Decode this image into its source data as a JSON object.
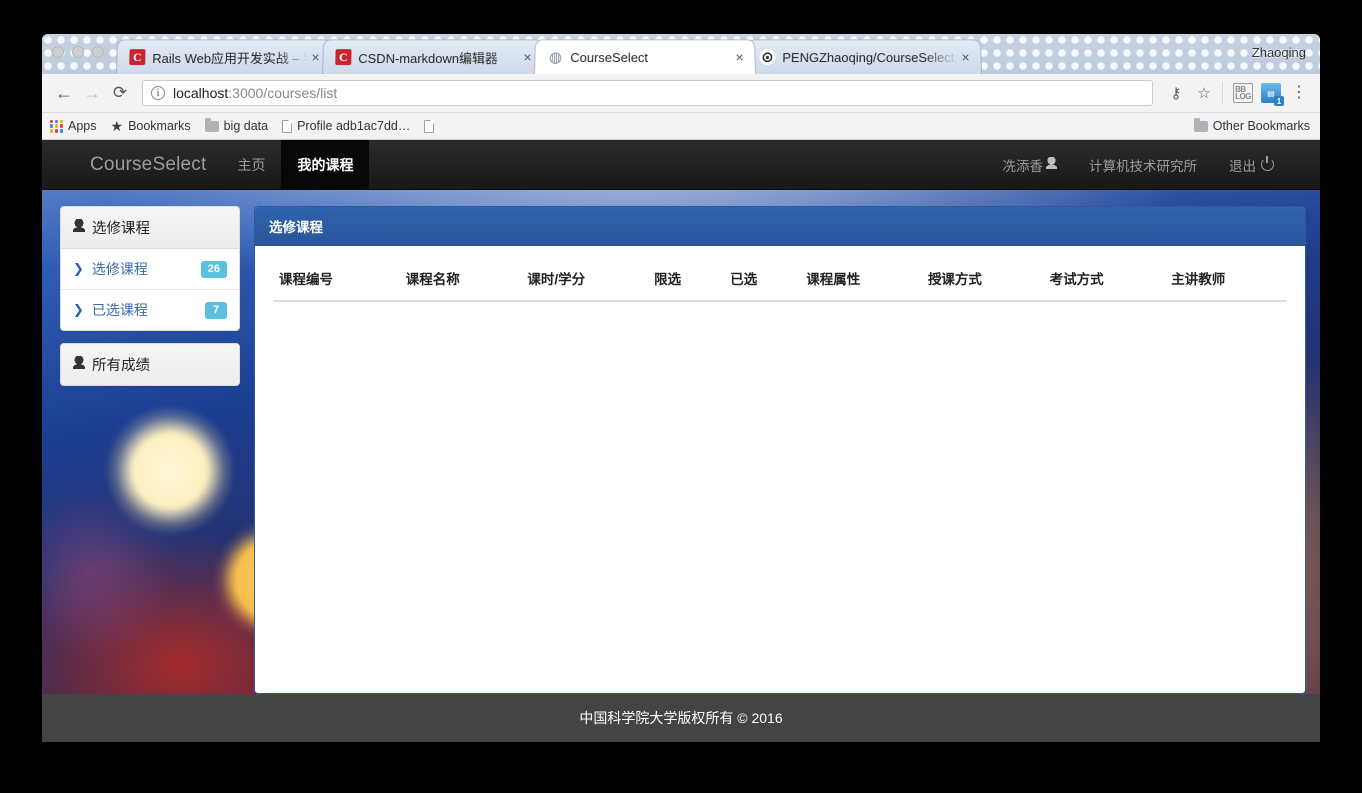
{
  "browser": {
    "window_user": "Zhaoqing",
    "tabs": [
      {
        "title": "Rails Web应用开发实战 – 学生选课系统",
        "favicon": "csdn-icon",
        "active": false,
        "close_label": "×"
      },
      {
        "title": "CSDN-markdown编辑器",
        "favicon": "csdn-icon",
        "active": false,
        "close_label": "×"
      },
      {
        "title": "CourseSelect",
        "favicon": "page-icon",
        "active": true,
        "close_label": "×"
      },
      {
        "title": "PENGZhaoqing/CourseSelect:",
        "favicon": "github-icon",
        "active": false,
        "close_label": "×"
      }
    ],
    "toolbar": {
      "back_glyph": "←",
      "forward_glyph": "→",
      "reload_glyph": "⟳",
      "url_host": "localhost",
      "url_path": ":3000/courses/list",
      "url_full": "localhost:3000/courses/list",
      "key_glyph": "⚷",
      "star_glyph": "☆",
      "ext_blog_label": "BB LOG",
      "menu_glyph": "⋮"
    },
    "bookmarks": [
      {
        "label": "Apps",
        "icon": "apps-grid-icon"
      },
      {
        "label": "Bookmarks",
        "icon": "star-icon"
      },
      {
        "label": "big data",
        "icon": "folder-icon"
      },
      {
        "label": "Profile adb1ac7dd…",
        "icon": "document-icon"
      },
      {
        "label": "",
        "icon": "document-icon"
      }
    ],
    "other_bookmarks": "Other Bookmarks"
  },
  "navbar": {
    "brand": "CourseSelect",
    "items": [
      {
        "label": "主页",
        "active": false
      },
      {
        "label": "我的课程",
        "active": true
      }
    ],
    "right_items": [
      {
        "label": "冼添香",
        "icon": "user-icon"
      },
      {
        "label": "计算机技术研究所",
        "icon": ""
      },
      {
        "label": "退出",
        "icon": "power-icon"
      }
    ]
  },
  "sidebar": {
    "panels": [
      {
        "header": "选修课程",
        "header_icon": "user-icon",
        "items": [
          {
            "label": "选修课程",
            "badge": "26"
          },
          {
            "label": "已选课程",
            "badge": "7"
          }
        ]
      },
      {
        "header": "所有成绩",
        "header_icon": "user-icon",
        "items": []
      }
    ]
  },
  "main": {
    "panel_title": "选修课程",
    "table": {
      "columns": [
        "课程编号",
        "课程名称",
        "课时/学分",
        "限选",
        "已选",
        "课程属性",
        "授课方式",
        "考试方式",
        "主讲教师"
      ],
      "rows": []
    }
  },
  "footer": {
    "text": "中国科学院大学版权所有 © 2016"
  },
  "colors": {
    "panel_header_blue": "#2f63ad",
    "badge_blue": "#5bc0de",
    "navbar_dark": "#222222",
    "footer_grey": "#444444",
    "link_blue": "#3a6bb0"
  }
}
